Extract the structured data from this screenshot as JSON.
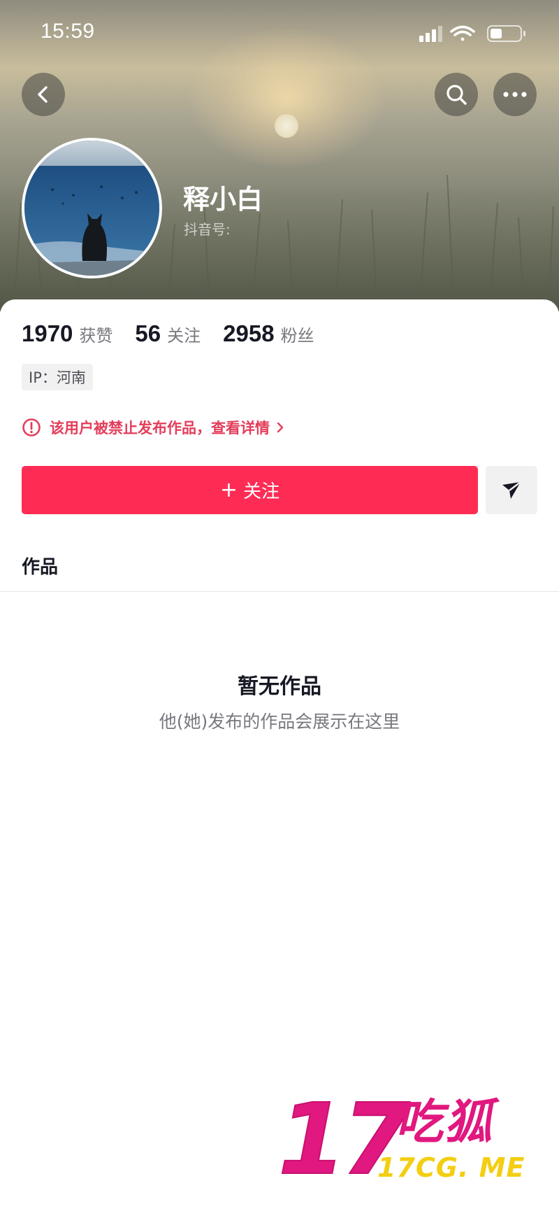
{
  "status_bar": {
    "time": "15:59"
  },
  "profile": {
    "nickname": "释小白",
    "douyin_id_label": "抖音号:",
    "stats": [
      {
        "value": "1970",
        "label": "获赞"
      },
      {
        "value": "56",
        "label": "关注"
      },
      {
        "value": "2958",
        "label": "粉丝"
      }
    ],
    "ip_tag": "IP：河南",
    "ban_notice": "该用户被禁止发布作品，查看详情"
  },
  "actions": {
    "follow_plus": "+",
    "follow_label": "关注"
  },
  "tabs": {
    "works": "作品"
  },
  "empty_state": {
    "title": "暂无作品",
    "subtitle": "他(她)发布的作品会展示在这里"
  },
  "watermark": {
    "number": "17",
    "name": "吃狐",
    "domain": "17CG. ME"
  },
  "colors": {
    "accent": "#fe2c55",
    "warning_text": "#e43d5b",
    "primary_text": "#161823",
    "secondary_text": "#77787e",
    "watermark_magenta": "#e0187f",
    "watermark_yellow": "#f3ce12"
  },
  "icons": {
    "back": "chevron-left-icon",
    "search": "search-icon",
    "more": "more-dots-icon",
    "signal": "signal-icon",
    "wifi": "wifi-icon",
    "battery": "battery-icon",
    "warning": "warning-circle-icon",
    "share": "send-arrow-icon"
  }
}
